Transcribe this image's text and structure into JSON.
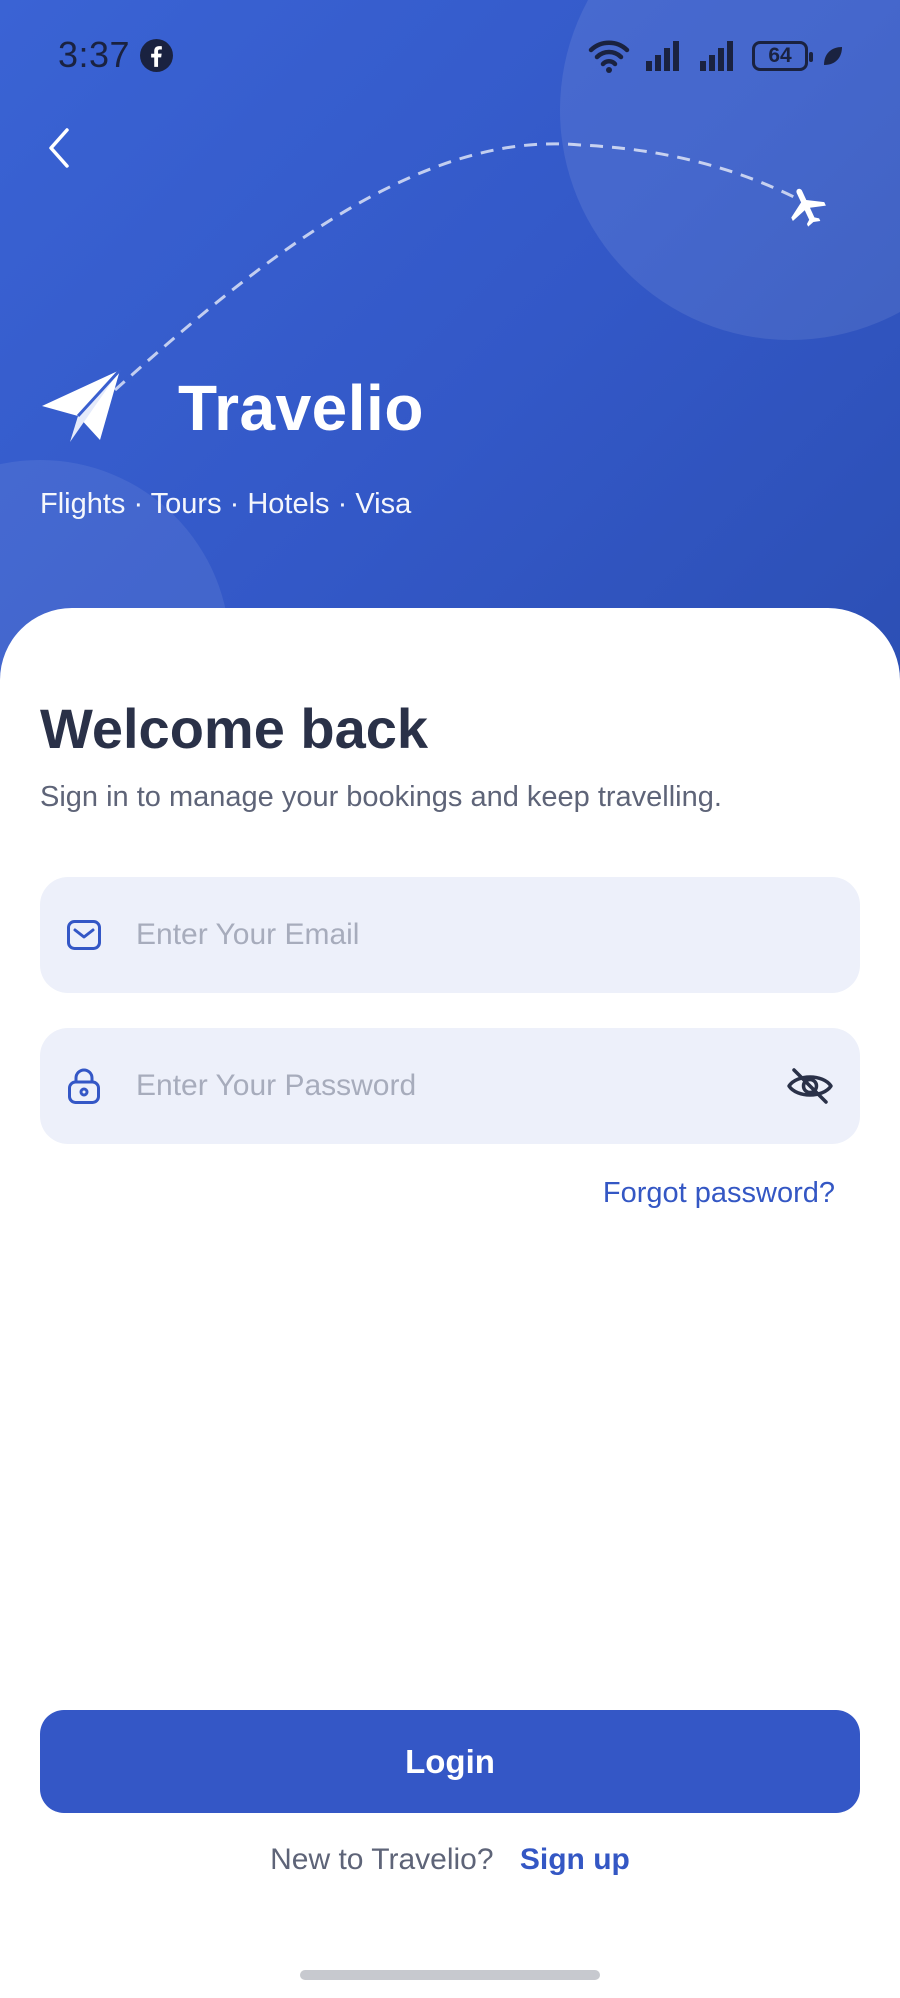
{
  "status_bar": {
    "time": "3:37",
    "battery_level": "64",
    "icons": [
      "facebook-icon",
      "wifi-icon",
      "signal-icon",
      "signal-icon",
      "battery-icon",
      "leaf-icon"
    ]
  },
  "header": {
    "back_icon": "chevron-left-icon",
    "brand_name": "Travelio",
    "tagline": "Flights · Tours · Hotels · Visa",
    "colors": {
      "hero_start": "#3a63d4",
      "hero_end": "#2c4fb4"
    }
  },
  "form": {
    "title": "Welcome back",
    "subtitle": "Sign in to manage your bookings and keep travelling.",
    "email": {
      "placeholder": "Enter Your Email",
      "value": "",
      "icon": "mail-icon"
    },
    "password": {
      "placeholder": "Enter Your Password",
      "value": "",
      "icon": "lock-icon",
      "toggle_icon": "eye-off-icon"
    },
    "forgot_label": "Forgot password?"
  },
  "actions": {
    "login_label": "Login",
    "signup_prompt": "New to Travelio?",
    "signup_label": "Sign up",
    "accent_color": "#3457c6"
  }
}
